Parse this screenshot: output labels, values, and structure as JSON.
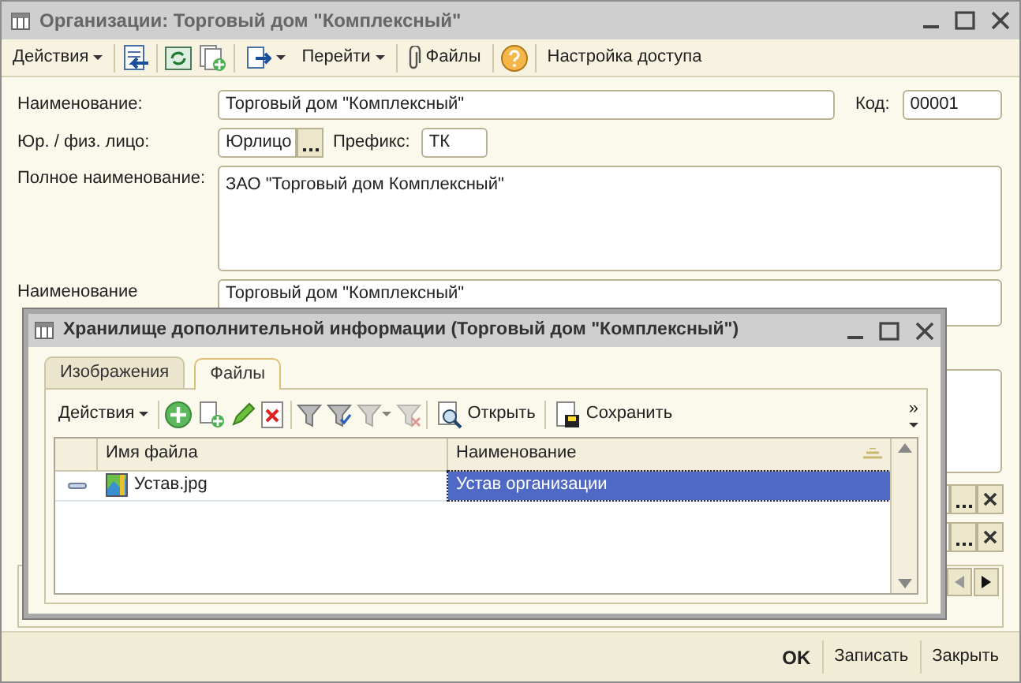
{
  "window": {
    "title": "Организации: Торговый дом \"Комплексный\""
  },
  "toolbar": {
    "actions": "Действия",
    "goto": "Перейти",
    "files": "Файлы",
    "access": "Настройка доступа"
  },
  "form": {
    "name_label": "Наименование:",
    "name_value": "Торговый дом \"Комплексный\"",
    "code_label": "Код:",
    "code_value": "00001",
    "legal_label": "Юр. / физ. лицо:",
    "legal_value": "Юрлицо",
    "prefix_label": "Префикс:",
    "prefix_value": "ТК",
    "full_name_label": "Полное наименование:",
    "full_name_value": "ЗАО \"Торговый дом Комплексный\"",
    "short_name_label": "Наименование",
    "short_name_value": "Торговый дом \"Комплексный\""
  },
  "dialog": {
    "title": "Хранилище дополнительной информации (Торговый дом \"Комплексный\")",
    "tabs": [
      {
        "label": "Изображения",
        "selected": false
      },
      {
        "label": "Файлы",
        "selected": true
      }
    ],
    "toolbar": {
      "actions": "Действия",
      "open": "Открыть",
      "save": "Сохранить",
      "more": "»"
    },
    "table": {
      "columns": [
        "Имя файла",
        "Наименование"
      ],
      "rows": [
        {
          "file": "Устав.jpg",
          "name": "Устав организации",
          "selected": true
        }
      ]
    }
  },
  "footer": [
    {
      "label": "OK",
      "primary": true
    },
    {
      "label": "Записать",
      "primary": false
    },
    {
      "label": "Закрыть",
      "primary": false
    }
  ]
}
